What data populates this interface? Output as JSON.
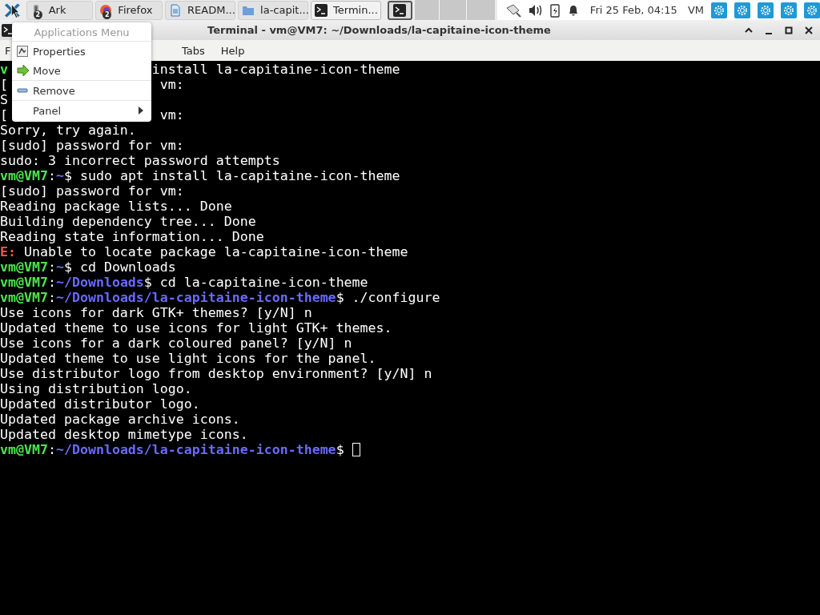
{
  "taskbar": {
    "tasks": [
      {
        "kind": "archive",
        "label": "Ark",
        "badge": "2",
        "selected": false
      },
      {
        "kind": "browser",
        "label": "Firefox",
        "badge": "2",
        "selected": false
      },
      {
        "kind": "document",
        "label": "READM...",
        "selected": false
      },
      {
        "kind": "folder",
        "label": "la-capit...",
        "selected": false
      },
      {
        "kind": "terminal",
        "label": "Termin...",
        "selected": true
      }
    ],
    "clock": "Fri 25 Feb, 04:15",
    "user": "VM"
  },
  "window": {
    "title": "Terminal - vm@VM7: ~/Downloads/la-capitaine-icon-theme",
    "menu": [
      "F",
      "Tabs",
      "Help"
    ]
  },
  "popup_menu": {
    "header": "Applications Menu",
    "items": [
      {
        "kind": "properties",
        "label": "Properties"
      },
      {
        "kind": "move",
        "label": "Move"
      },
      {
        "kind": "remove",
        "label": "Remove"
      },
      {
        "kind": "submenu",
        "label": "Panel"
      }
    ]
  },
  "terminal": {
    "lines": [
      [
        {
          "kind": "user",
          "text": "v"
        },
        {
          "kind": "text",
          "text": "                  install la-capitaine-icon-theme"
        }
      ],
      [
        {
          "kind": "text",
          "text": "["
        },
        {
          "kind": "text",
          "text": "                   vm:"
        }
      ],
      [
        {
          "kind": "text",
          "text": "S"
        }
      ],
      [
        {
          "kind": "text",
          "text": "["
        },
        {
          "kind": "text",
          "text": "                   vm:"
        }
      ],
      [
        {
          "kind": "text",
          "text": "Sorry, try again."
        }
      ],
      [
        {
          "kind": "text",
          "text": "[sudo] password for vm:"
        }
      ],
      [
        {
          "kind": "text",
          "text": "sudo: 3 incorrect password attempts"
        }
      ],
      [
        {
          "kind": "user",
          "text": "vm@VM7"
        },
        {
          "kind": "text",
          "text": ":"
        },
        {
          "kind": "path",
          "text": "~"
        },
        {
          "kind": "text",
          "text": "$ sudo apt install la-capitaine-icon-theme"
        }
      ],
      [
        {
          "kind": "text",
          "text": "[sudo] password for vm:"
        }
      ],
      [
        {
          "kind": "text",
          "text": "Reading package lists... Done"
        }
      ],
      [
        {
          "kind": "text",
          "text": "Building dependency tree... Done"
        }
      ],
      [
        {
          "kind": "text",
          "text": "Reading state information... Done"
        }
      ],
      [
        {
          "kind": "error",
          "text": "E:"
        },
        {
          "kind": "text",
          "text": " Unable to locate package la-capitaine-icon-theme"
        }
      ],
      [
        {
          "kind": "user",
          "text": "vm@VM7"
        },
        {
          "kind": "text",
          "text": ":"
        },
        {
          "kind": "path",
          "text": "~"
        },
        {
          "kind": "text",
          "text": "$ cd Downloads"
        }
      ],
      [
        {
          "kind": "user",
          "text": "vm@VM7"
        },
        {
          "kind": "text",
          "text": ":"
        },
        {
          "kind": "path",
          "text": "~/Downloads"
        },
        {
          "kind": "text",
          "text": "$ cd la-capitaine-icon-theme"
        }
      ],
      [
        {
          "kind": "user",
          "text": "vm@VM7"
        },
        {
          "kind": "text",
          "text": ":"
        },
        {
          "kind": "path",
          "text": "~/Downloads/la-capitaine-icon-theme"
        },
        {
          "kind": "text",
          "text": "$ ./configure"
        }
      ],
      [
        {
          "kind": "text",
          "text": "Use icons for dark GTK+ themes? [y/N] n"
        }
      ],
      [
        {
          "kind": "text",
          "text": "Updated theme to use icons for light GTK+ themes."
        }
      ],
      [
        {
          "kind": "text",
          "text": "Use icons for a dark coloured panel? [y/N] n"
        }
      ],
      [
        {
          "kind": "text",
          "text": "Updated theme to use light icons for the panel."
        }
      ],
      [
        {
          "kind": "text",
          "text": "Use distributor logo from desktop environment? [y/N] n"
        }
      ],
      [
        {
          "kind": "text",
          "text": "Using distribution logo."
        }
      ],
      [
        {
          "kind": "text",
          "text": "Updated distributor logo."
        }
      ],
      [
        {
          "kind": "text",
          "text": "Updated package archive icons."
        }
      ],
      [
        {
          "kind": "text",
          "text": "Updated desktop mimetype icons."
        }
      ],
      [
        {
          "kind": "user",
          "text": "vm@VM7"
        },
        {
          "kind": "text",
          "text": ":"
        },
        {
          "kind": "path",
          "text": "~/Downloads/la-capitaine-icon-theme"
        },
        {
          "kind": "text",
          "text": "$ "
        },
        {
          "kind": "cursor"
        }
      ]
    ]
  }
}
